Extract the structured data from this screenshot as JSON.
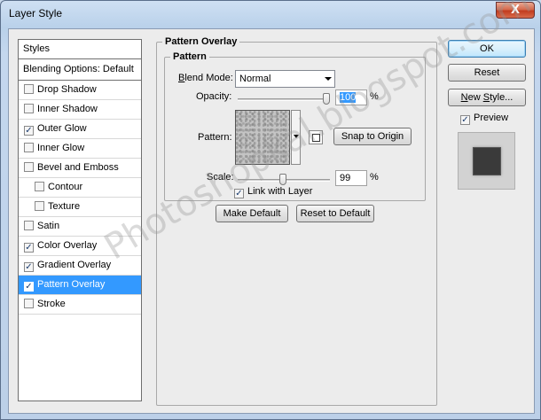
{
  "window": {
    "title": "Layer Style",
    "close_label": "X"
  },
  "styles_panel": {
    "header": "Styles",
    "blending_options": "Blending Options: Default",
    "items": [
      {
        "label": "Drop Shadow",
        "checked": false,
        "indent": false,
        "selected": false
      },
      {
        "label": "Inner Shadow",
        "checked": false,
        "indent": false,
        "selected": false
      },
      {
        "label": "Outer Glow",
        "checked": true,
        "indent": false,
        "selected": false
      },
      {
        "label": "Inner Glow",
        "checked": false,
        "indent": false,
        "selected": false
      },
      {
        "label": "Bevel and Emboss",
        "checked": false,
        "indent": false,
        "selected": false
      },
      {
        "label": "Contour",
        "checked": false,
        "indent": true,
        "selected": false
      },
      {
        "label": "Texture",
        "checked": false,
        "indent": true,
        "selected": false
      },
      {
        "label": "Satin",
        "checked": false,
        "indent": false,
        "selected": false
      },
      {
        "label": "Color Overlay",
        "checked": true,
        "indent": false,
        "selected": false
      },
      {
        "label": "Gradient Overlay",
        "checked": true,
        "indent": false,
        "selected": false
      },
      {
        "label": "Pattern Overlay",
        "checked": true,
        "indent": false,
        "selected": true
      },
      {
        "label": "Stroke",
        "checked": false,
        "indent": false,
        "selected": false
      }
    ]
  },
  "pattern_overlay": {
    "title": "Pattern Overlay",
    "pattern_group_title": "Pattern",
    "blend_mode_label": "Blend Mode:",
    "blend_mode_value": "Normal",
    "opacity_label": "Opacity:",
    "opacity_value": "100",
    "opacity_level": 1.0,
    "percent": "%",
    "pattern_label": "Pattern:",
    "snap_to_origin": "Snap to Origin",
    "scale_label": "Scale:",
    "scale_value": "99",
    "scale_level": 0.49,
    "link_with_layer": "Link with Layer",
    "link_checked": true,
    "make_default": "Make Default",
    "reset_to_default": "Reset to Default"
  },
  "actions": {
    "ok": "OK",
    "reset": "Reset",
    "new_style": "New Style...",
    "preview_label": "Preview",
    "preview_checked": true
  },
  "watermark": "Photoshopkal.blogspot.com",
  "colors": {
    "selection": "#3399ff",
    "dialog_bg": "#ececec",
    "preview_fill": "#3a3a3a"
  }
}
